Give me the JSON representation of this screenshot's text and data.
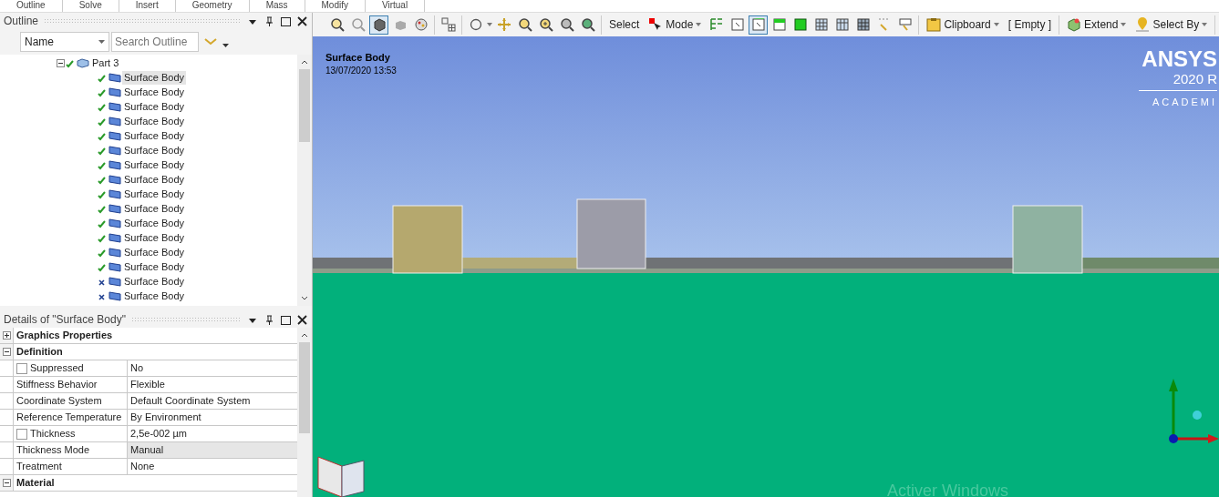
{
  "ribbon_groups": [
    "Outline",
    "Solve",
    "Insert",
    "Geometry",
    "Mass",
    "Modify",
    "Virtual"
  ],
  "outline": {
    "title": "Outline",
    "filter": "Name",
    "search": {
      "placeholder": "Search Outline"
    },
    "tree": {
      "label": "Part 3",
      "expanded": true,
      "children": [
        {
          "label": "Surface Body",
          "valid": true,
          "selected": true
        },
        {
          "label": "Surface Body",
          "valid": true,
          "selected": false
        },
        {
          "label": "Surface Body",
          "valid": true,
          "selected": false
        },
        {
          "label": "Surface Body",
          "valid": true,
          "selected": false
        },
        {
          "label": "Surface Body",
          "valid": true,
          "selected": false
        },
        {
          "label": "Surface Body",
          "valid": true,
          "selected": false
        },
        {
          "label": "Surface Body",
          "valid": true,
          "selected": false
        },
        {
          "label": "Surface Body",
          "valid": true,
          "selected": false
        },
        {
          "label": "Surface Body",
          "valid": true,
          "selected": false
        },
        {
          "label": "Surface Body",
          "valid": true,
          "selected": false
        },
        {
          "label": "Surface Body",
          "valid": true,
          "selected": false
        },
        {
          "label": "Surface Body",
          "valid": true,
          "selected": false
        },
        {
          "label": "Surface Body",
          "valid": true,
          "selected": false
        },
        {
          "label": "Surface Body",
          "valid": true,
          "selected": false
        },
        {
          "label": "Surface Body",
          "valid": false,
          "selected": false
        },
        {
          "label": "Surface Body",
          "valid": false,
          "selected": false
        }
      ]
    }
  },
  "details": {
    "title": "Details of \"Surface Body\"",
    "sections": [
      {
        "title": "Graphics Properties",
        "expanded": false
      },
      {
        "title": "Definition",
        "expanded": true,
        "rows": [
          {
            "kind": "checkbox",
            "checked": false,
            "property": "Suppressed",
            "value": "No",
            "highlighted": false
          },
          {
            "kind": "plain",
            "property": "Stiffness Behavior",
            "value": "Flexible",
            "highlighted": false
          },
          {
            "kind": "plain",
            "property": "Coordinate System",
            "value": "Default Coordinate System",
            "highlighted": false
          },
          {
            "kind": "plain",
            "property": "Reference Temperature",
            "value": "By Environment",
            "highlighted": false
          },
          {
            "kind": "checkbox",
            "checked": false,
            "property": "Thickness",
            "value": "2,5e-002 µm",
            "highlighted": false
          },
          {
            "kind": "plain",
            "property": "Thickness Mode",
            "value": "Manual",
            "highlighted": true
          },
          {
            "kind": "plain",
            "property": "Treatment",
            "value": "None",
            "highlighted": false
          }
        ]
      },
      {
        "title": "Material",
        "expanded": true
      }
    ]
  },
  "toolbar": [
    [
      {
        "kind": "icon",
        "pressed": false
      },
      {
        "kind": "icon",
        "pressed": false
      },
      {
        "kind": "icon",
        "pressed": true
      },
      {
        "kind": "icon",
        "pressed": false
      },
      {
        "kind": "icon",
        "pressed": false
      }
    ],
    [
      {
        "kind": "icon",
        "pressed": false
      }
    ],
    [
      {
        "kind": "icon",
        "pressed": false,
        "dropdown": true
      },
      {
        "kind": "icon",
        "pressed": false
      },
      {
        "kind": "icon",
        "pressed": false
      },
      {
        "kind": "icon",
        "pressed": false
      },
      {
        "kind": "icon",
        "pressed": false
      },
      {
        "kind": "icon",
        "pressed": false
      }
    ],
    [
      {
        "kind": "text",
        "label": "Select",
        "dropdown": false
      },
      {
        "kind": "text",
        "label": "Mode",
        "dropdown": true,
        "icon": true
      },
      {
        "kind": "icon",
        "pressed": false
      },
      {
        "kind": "icon",
        "pressed": false
      },
      {
        "kind": "icon",
        "pressed": true
      },
      {
        "kind": "icon",
        "pressed": false
      },
      {
        "kind": "icon",
        "pressed": false
      },
      {
        "kind": "icon",
        "pressed": false
      },
      {
        "kind": "icon",
        "pressed": false
      },
      {
        "kind": "icon",
        "pressed": false
      },
      {
        "kind": "icon",
        "pressed": false
      },
      {
        "kind": "icon",
        "pressed": false
      }
    ],
    [
      {
        "kind": "text",
        "label": "Clipboard",
        "dropdown": true,
        "icon": true
      },
      {
        "kind": "text",
        "label": "[ Empty ]",
        "dropdown": false
      }
    ],
    [
      {
        "kind": "text",
        "label": "Extend",
        "dropdown": true,
        "icon": true
      },
      {
        "kind": "text",
        "label": "Select By",
        "dropdown": true,
        "icon": true
      }
    ]
  ],
  "viewport": {
    "title": "Surface Body",
    "timestamp": "13/07/2020 13:53",
    "logo": {
      "brand": "ANSYS",
      "version": "2020 R",
      "edition": "ACADEMI"
    },
    "notice": "Activer Windows"
  }
}
